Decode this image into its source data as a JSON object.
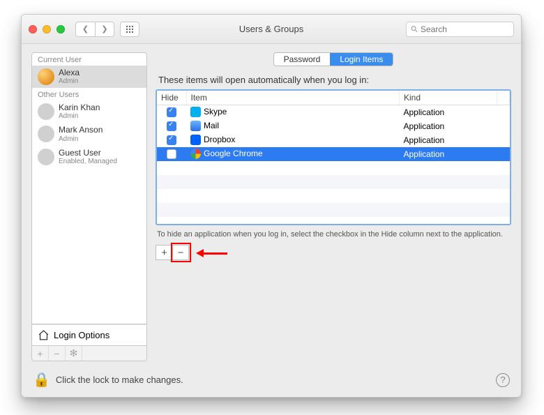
{
  "window": {
    "title": "Users & Groups"
  },
  "search": {
    "placeholder": "Search"
  },
  "sidebar": {
    "section_current": "Current User",
    "section_other": "Other Users",
    "users": [
      {
        "name": "Alexa",
        "role": "Admin"
      },
      {
        "name": "Karin Khan",
        "role": "Admin"
      },
      {
        "name": "Mark Anson",
        "role": "Admin"
      },
      {
        "name": "Guest User",
        "role": "Enabled, Managed"
      }
    ],
    "login_options_label": "Login Options"
  },
  "tabs": {
    "password": "Password",
    "login_items": "Login Items"
  },
  "content": {
    "subtitle": "These items will open automatically when you log in:",
    "columns": {
      "hide": "Hide",
      "item": "Item",
      "kind": "Kind"
    },
    "rows": [
      {
        "hide": true,
        "item": "Skype",
        "kind": "Application",
        "icon_color": "#00aff0"
      },
      {
        "hide": true,
        "item": "Mail",
        "kind": "Application",
        "icon_color": "#3a82f0"
      },
      {
        "hide": true,
        "item": "Dropbox",
        "kind": "Application",
        "icon_color": "#0061ff"
      },
      {
        "hide": false,
        "item": "Google Chrome",
        "kind": "Application",
        "icon_color": "#f4c20d",
        "selected": true
      }
    ],
    "hint": "To hide an application when you log in, select the checkbox in the Hide column next to the application."
  },
  "footer": {
    "lock_text": "Click the lock to make changes."
  }
}
